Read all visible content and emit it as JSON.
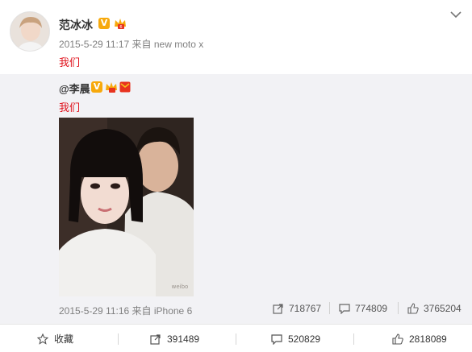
{
  "post": {
    "author": "范冰冰",
    "timestamp": "2015-5-29 11:17",
    "source": "来自 new moto x",
    "text": "我们"
  },
  "repost": {
    "author": "@李晨",
    "text": "我们",
    "timestamp": "2015-5-29 11:16",
    "source": "来自 iPhone 6",
    "stats": {
      "forwards": "718767",
      "comments": "774809",
      "likes": "3765204"
    }
  },
  "actions": {
    "favorite": "收藏",
    "forwards": "391489",
    "comments": "520829",
    "likes": "2818089"
  },
  "icons": {
    "badge_verified": "v-badge-icon",
    "badge_member": "crown-icon",
    "menu": "chevron-down-icon",
    "forward": "forward-icon",
    "comment": "comment-icon",
    "like": "thumbs-up-icon",
    "favorite": "star-icon"
  },
  "colors": {
    "text_link_red": "#e0111b",
    "badge_orange": "#f7a90c",
    "repost_bg": "#f2f2f5"
  }
}
